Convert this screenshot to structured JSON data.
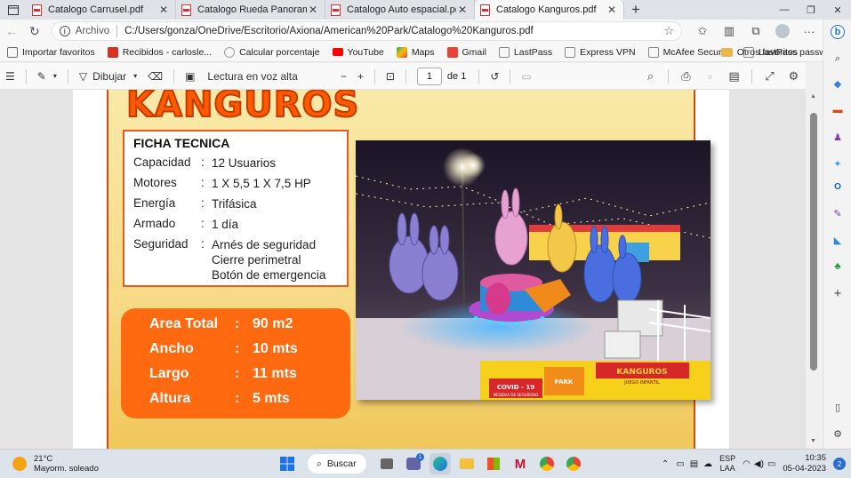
{
  "tabs": [
    {
      "title": "Catalogo Carrusel.pdf",
      "active": false
    },
    {
      "title": "Catalogo Rueda Panoramica.pdf",
      "active": false
    },
    {
      "title": "Catalogo Auto espacial.pdf",
      "active": false
    },
    {
      "title": "Catalogo Kanguros.pdf",
      "active": true
    }
  ],
  "address": {
    "scheme_label": "Archivo",
    "url": "C:/Users/gonza/OneDrive/Escritorio/Axiona/American%20Park/Catalogo%20Kanguros.pdf"
  },
  "bookmarks": [
    {
      "label": "Importar favoritos",
      "color": "#6b6b6b"
    },
    {
      "label": "Recibidos - carlosle...",
      "color": "#d93025"
    },
    {
      "label": "Calcular porcentaje",
      "color": "#9aa0a6"
    },
    {
      "label": "YouTube",
      "color": "#ff0000"
    },
    {
      "label": "Maps",
      "color": "#34a853"
    },
    {
      "label": "Gmail",
      "color": "#ea4335"
    },
    {
      "label": "LastPass",
      "color": "#8a8a8a"
    },
    {
      "label": "Express VPN",
      "color": "#8a8a8a"
    },
    {
      "label": "McAfee Security",
      "color": "#8a8a8a"
    },
    {
      "label": "LastPass password...",
      "color": "#8a8a8a"
    }
  ],
  "other_favorites": "Otros favoritos",
  "pdf_toolbar": {
    "draw_label": "Dibujar",
    "read_aloud": "Lectura en voz alta",
    "page_current": "1",
    "page_total": "de 1"
  },
  "document": {
    "title": "KANGUROS",
    "ficha": {
      "heading": "FICHA TECNICA",
      "rows": [
        {
          "key": "Capacidad",
          "colon": ":",
          "values": [
            "12 Usuarios"
          ]
        },
        {
          "key": "Motores",
          "colon": ":",
          "values": [
            "1 X 5,5 1 X 7,5 HP"
          ]
        },
        {
          "key": "Energía",
          "colon": ":",
          "values": [
            "Trifásica"
          ]
        },
        {
          "key": "Armado",
          "colon": ":",
          "values": [
            "1 día"
          ]
        },
        {
          "key": "Seguridad",
          "colon": ":",
          "values": [
            "Arnés de seguridad",
            "Cierre perimetral",
            "Botón de emergencia"
          ]
        }
      ]
    },
    "dimensions": [
      {
        "key": "Area Total",
        "colon": ":",
        "value": "90 m2"
      },
      {
        "key": "Ancho",
        "colon": ":",
        "value": "10 mts"
      },
      {
        "key": "Largo",
        "colon": ":",
        "value": "11 mts"
      },
      {
        "key": "Altura",
        "colon": ":",
        "value": "5 mts"
      }
    ],
    "photo_sign": {
      "name": "KANGUROS",
      "subtitle": "JUEGO INFANTIL",
      "covid": "COVID - 19",
      "covid_sub": "MEDIDAS DE SEGURIDAD",
      "park": "PARK"
    }
  },
  "taskbar": {
    "temperature": "21°C",
    "weather": "Mayorm. soleado",
    "search": "Buscar",
    "lang_top": "ESP",
    "lang_bottom": "LAA",
    "time": "10:35",
    "date": "05-04-2023",
    "notifications": "2",
    "teams_badge": "1"
  },
  "colors": {
    "title_orange": "#ff5a00",
    "dims_orange": "#ff6a10",
    "border_orange": "#e85c1e"
  }
}
